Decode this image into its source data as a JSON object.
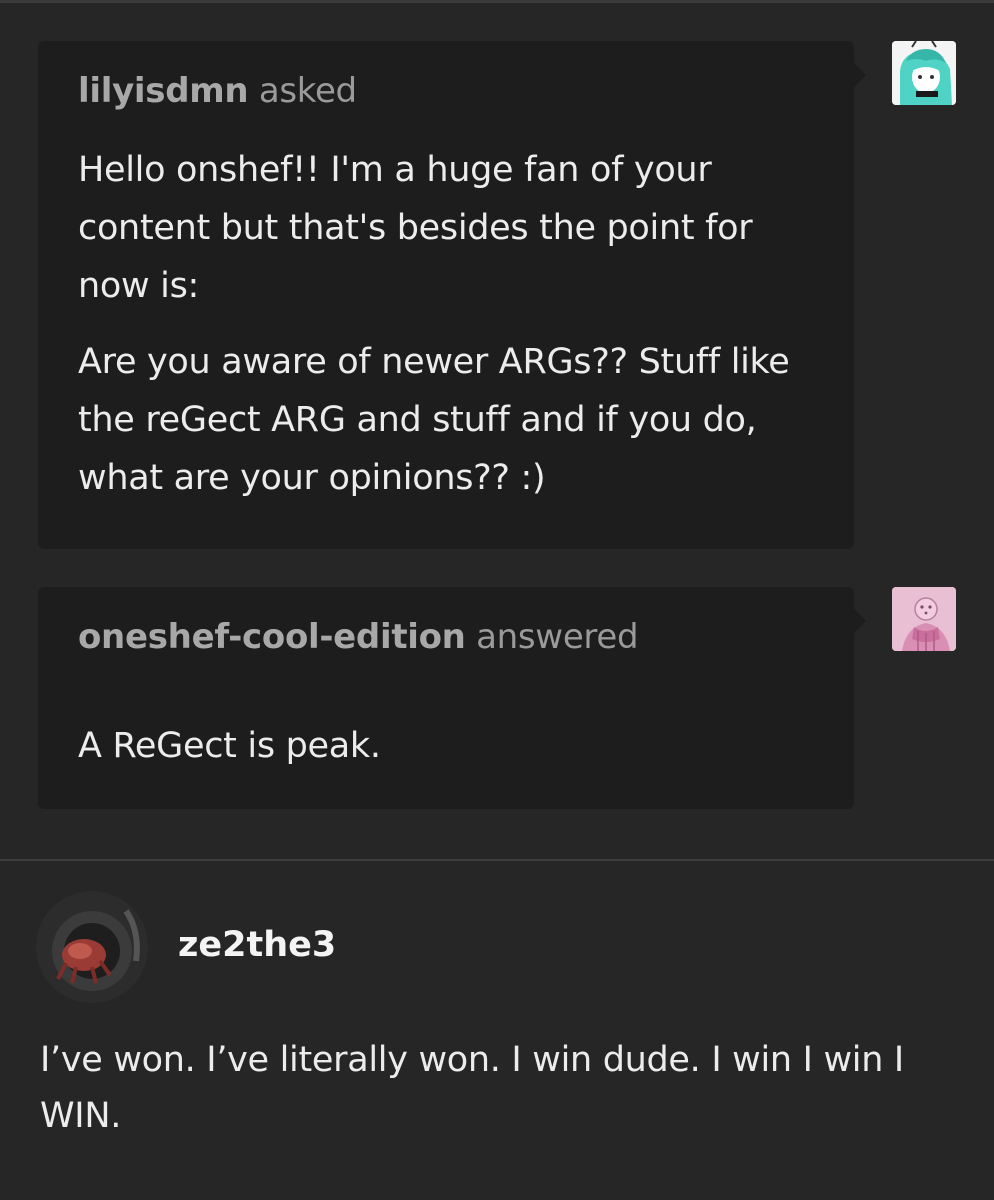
{
  "ask": {
    "username": "lilyisdmn",
    "action": "asked",
    "paragraphs": [
      "Hello onshef!! I'm a huge fan of your content but that's besides the point for now is:",
      "Are you aware of newer ARGs?? Stuff like the reGect ARG and stuff and if you do, what are your opinions?? :)"
    ],
    "avatar_icon": "teal-haired-character-avatar-icon"
  },
  "answer": {
    "username": "oneshef-cool-edition",
    "action": "answered",
    "text": "A ReGect is peak.",
    "avatar_icon": "pink-character-avatar-icon"
  },
  "reblog": {
    "username": "ze2the3",
    "text": "I’ve won. I’ve literally won. I win dude. I win I win I WIN.",
    "avatar_icon": "red-creature-avatar-icon"
  },
  "colors": {
    "background": "#262626",
    "bubble": "#1d1d1d",
    "muted_text": "#9a9a9a",
    "text": "#ececec"
  }
}
